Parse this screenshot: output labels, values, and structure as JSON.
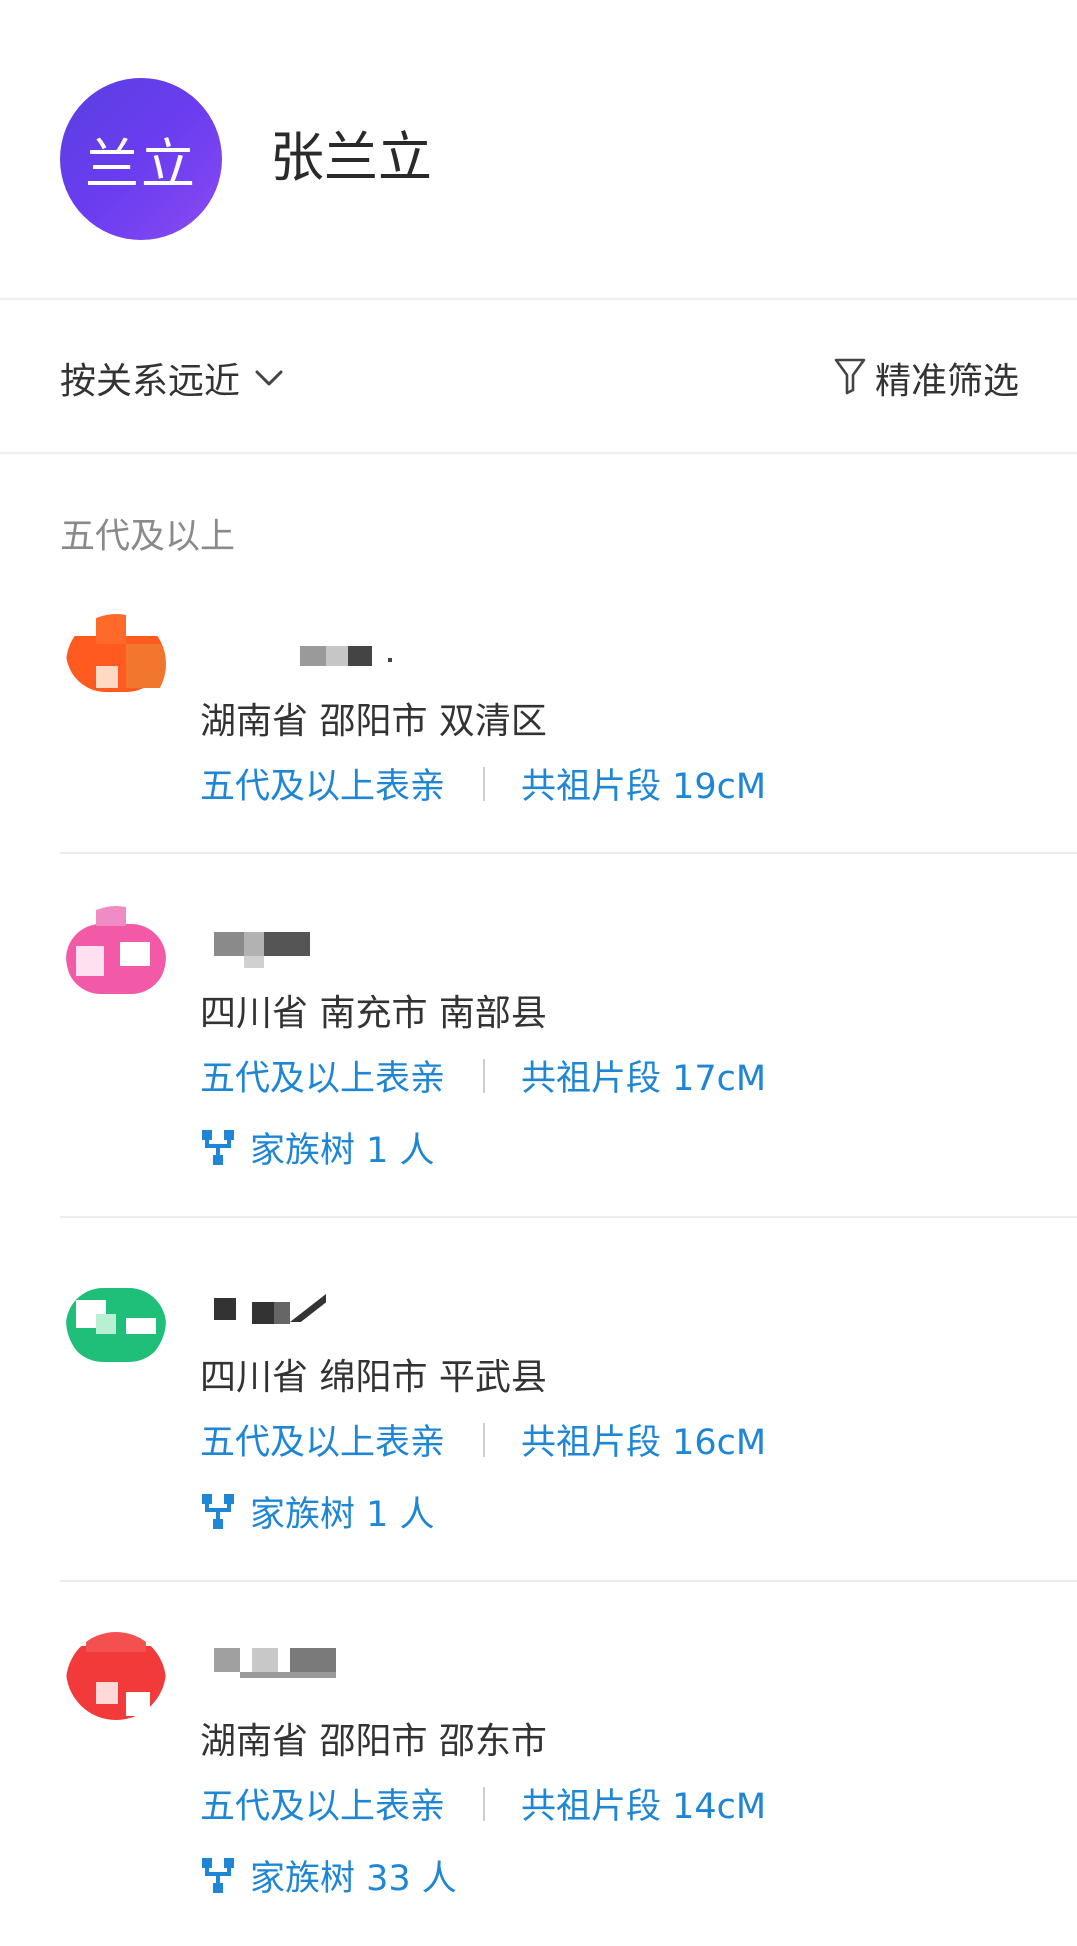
{
  "profile": {
    "avatar_text": "兰立",
    "name": "张兰立"
  },
  "toolbar": {
    "sort_label": "按关系远近",
    "filter_label": "精准筛选"
  },
  "section_title": "五代及以上",
  "matches": [
    {
      "location": "湖南省 邵阳市 双清区",
      "relation": "五代及以上表亲",
      "segment": "共祖片段 19cM",
      "family_tree": null
    },
    {
      "location": "四川省 南充市 南部县",
      "relation": "五代及以上表亲",
      "segment": "共祖片段 17cM",
      "family_tree": "家族树 1 人"
    },
    {
      "location": "四川省 绵阳市 平武县",
      "relation": "五代及以上表亲",
      "segment": "共祖片段 16cM",
      "family_tree": "家族树 1 人"
    },
    {
      "location": "湖南省 邵阳市 邵东市",
      "relation": "五代及以上表亲",
      "segment": "共祖片段 14cM",
      "family_tree": "家族树 33 人"
    }
  ],
  "colors": {
    "link_blue": "#1f86d6",
    "header_avatar": "#6a3df0"
  },
  "icons": {
    "sort": "chevron-down-icon",
    "filter": "funnel-icon",
    "family_tree": "family-tree-icon"
  }
}
